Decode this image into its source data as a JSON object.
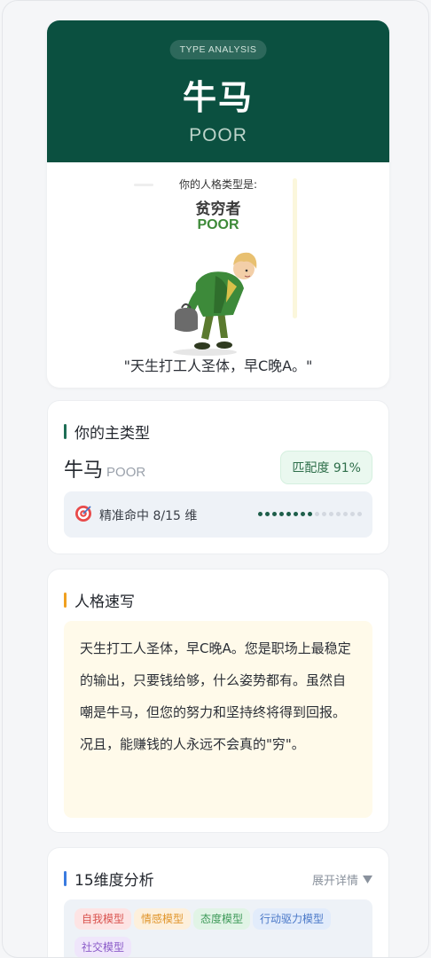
{
  "hero": {
    "badge": "TYPE ANALYSIS",
    "title": "牛马",
    "subtitle": "POOR",
    "image": {
      "caption": "你的人格类型是:",
      "type_cn": "贫穷者",
      "type_en": "POOR"
    },
    "quote": "\"天生打工人圣体，早C晚A。\""
  },
  "main_type": {
    "heading": "你的主类型",
    "name": "牛马",
    "name_en": "POOR",
    "match": "匹配度 91%",
    "hit_text": "精准命中 8/15 维",
    "hit": 8,
    "total": 15
  },
  "sketch": {
    "heading": "人格速写",
    "text": "天生打工人圣体，早C晚A。您是职场上最稳定的输出，只要钱给够，什么姿势都有。虽然自嘲是牛马，但您的努力和坚持终将得到回报。况且，能赚钱的人永远不会真的\"穷\"。"
  },
  "dimensions": {
    "heading": "15维度分析",
    "expand_label": "展开详情",
    "tags": [
      {
        "label": "自我模型",
        "bg": "#fde4e4",
        "fg": "#d9534f"
      },
      {
        "label": "情感模型",
        "bg": "#fdf0dc",
        "fg": "#e0952b"
      },
      {
        "label": "态度模型",
        "bg": "#e1f4e6",
        "fg": "#3f9a5a"
      },
      {
        "label": "行动驱力模型",
        "bg": "#e2ecfb",
        "fg": "#4a78c8"
      },
      {
        "label": "社交模型",
        "bg": "#efe6fb",
        "fg": "#8a5ac8"
      }
    ]
  },
  "colors": {
    "hero_bg": "#0b5040",
    "accent_green": "#1e6e55",
    "accent_orange": "#f0a020",
    "accent_blue": "#3a7be0"
  }
}
